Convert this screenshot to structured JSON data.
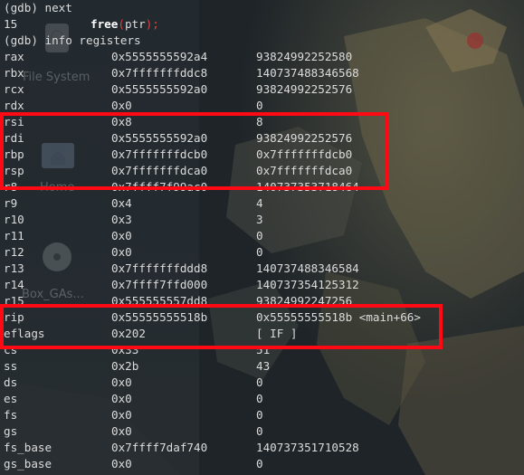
{
  "desktop": {
    "icons": [
      {
        "label": "File System",
        "icon": "drive-icon"
      },
      {
        "label": "Home",
        "icon": "home-folder-icon"
      },
      {
        "label": "Box_GAs...",
        "icon": "disc-icon"
      }
    ]
  },
  "terminal": {
    "lines": [
      {
        "kind": "cmd",
        "text": "(gdb) next"
      },
      {
        "kind": "src",
        "lineno": "15",
        "func": "free",
        "open": "(",
        "arg": "ptr",
        "close": ");"
      },
      {
        "kind": "cmd",
        "text": "(gdb) info registers"
      },
      {
        "kind": "reg",
        "name": "rax",
        "hex": "0x5555555592a4",
        "val": "93824992252580"
      },
      {
        "kind": "reg",
        "name": "rbx",
        "hex": "0x7fffffffddc8",
        "val": "140737488346568"
      },
      {
        "kind": "reg",
        "name": "rcx",
        "hex": "0x5555555592a0",
        "val": "93824992252576"
      },
      {
        "kind": "reg",
        "name": "rdx",
        "hex": "0x0",
        "val": "0"
      },
      {
        "kind": "reg",
        "name": "rsi",
        "hex": "0x8",
        "val": "8"
      },
      {
        "kind": "reg",
        "name": "rdi",
        "hex": "0x5555555592a0",
        "val": "93824992252576"
      },
      {
        "kind": "reg",
        "name": "rbp",
        "hex": "0x7fffffffdcb0",
        "val": "0x7fffffffdcb0"
      },
      {
        "kind": "reg",
        "name": "rsp",
        "hex": "0x7fffffffdca0",
        "val": "0x7fffffffdca0"
      },
      {
        "kind": "reg",
        "name": "r8",
        "hex": "0x7ffff7f99ac0",
        "val": "140737353718464"
      },
      {
        "kind": "reg",
        "name": "r9",
        "hex": "0x4",
        "val": "4"
      },
      {
        "kind": "reg",
        "name": "r10",
        "hex": "0x3",
        "val": "3"
      },
      {
        "kind": "reg",
        "name": "r11",
        "hex": "0x0",
        "val": "0"
      },
      {
        "kind": "reg",
        "name": "r12",
        "hex": "0x0",
        "val": "0"
      },
      {
        "kind": "reg",
        "name": "r13",
        "hex": "0x7fffffffddd8",
        "val": "140737488346584"
      },
      {
        "kind": "reg",
        "name": "r14",
        "hex": "0x7ffff7ffd000",
        "val": "140737354125312"
      },
      {
        "kind": "reg",
        "name": "r15",
        "hex": "0x555555557dd8",
        "val": "93824992247256"
      },
      {
        "kind": "reg",
        "name": "rip",
        "hex": "0x55555555518b",
        "val": "0x55555555518b <main+66>"
      },
      {
        "kind": "reg",
        "name": "eflags",
        "hex": "0x202",
        "val": "[ IF ]"
      },
      {
        "kind": "reg",
        "name": "cs",
        "hex": "0x33",
        "val": "51"
      },
      {
        "kind": "reg",
        "name": "ss",
        "hex": "0x2b",
        "val": "43"
      },
      {
        "kind": "reg",
        "name": "ds",
        "hex": "0x0",
        "val": "0"
      },
      {
        "kind": "reg",
        "name": "es",
        "hex": "0x0",
        "val": "0"
      },
      {
        "kind": "reg",
        "name": "fs",
        "hex": "0x0",
        "val": "0"
      },
      {
        "kind": "reg",
        "name": "gs",
        "hex": "0x0",
        "val": "0"
      },
      {
        "kind": "reg",
        "name": "fs_base",
        "hex": "0x7ffff7daf740",
        "val": "140737351710528"
      },
      {
        "kind": "reg",
        "name": "gs_base",
        "hex": "0x0",
        "val": "0"
      }
    ]
  },
  "colors": {
    "highlight_box": "#ff0a14",
    "keyword": "#ffffff",
    "paren": "#e04040",
    "text": "#dcdcdc"
  }
}
